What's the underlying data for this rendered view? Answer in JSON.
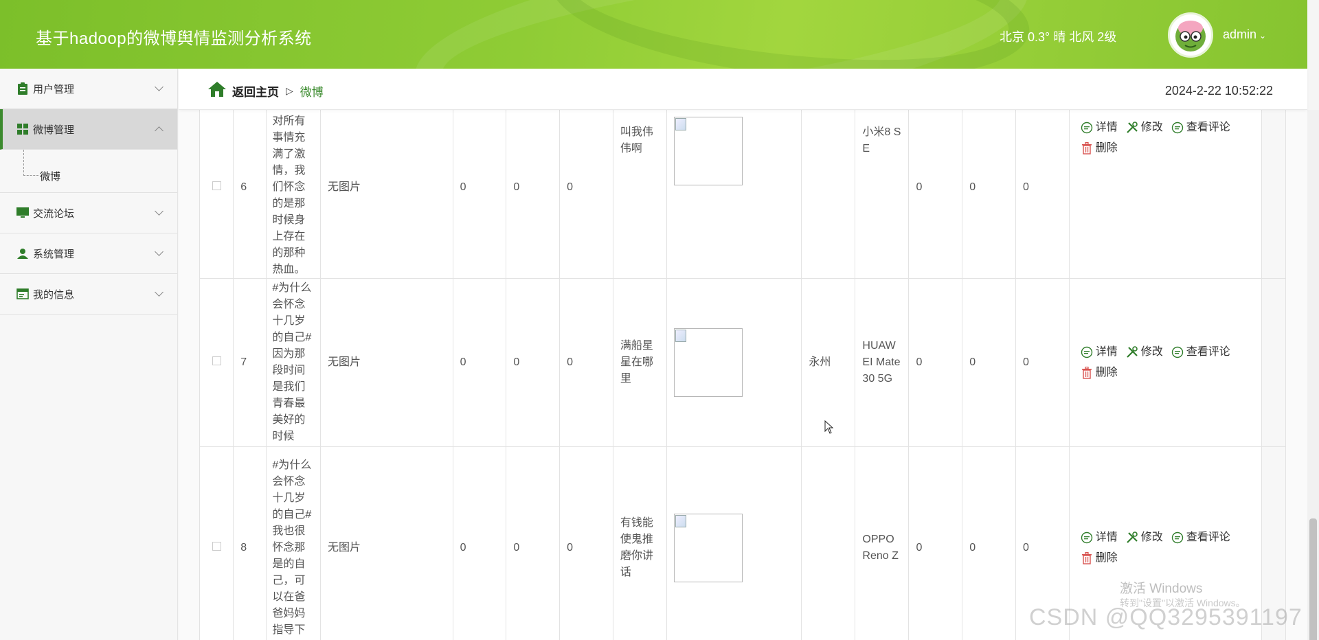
{
  "header": {
    "title": "基于hadoop的微博舆情监测分析系统",
    "weather": "北京 0.3° 晴 北风 2级",
    "user": "admin"
  },
  "sidebar": {
    "items": [
      {
        "label": "用户管理",
        "icon": "clipboard-icon"
      },
      {
        "label": "微博管理",
        "icon": "grid-icon"
      },
      {
        "label": "交流论坛",
        "icon": "monitor-icon"
      },
      {
        "label": "系统管理",
        "icon": "person-icon"
      },
      {
        "label": "我的信息",
        "icon": "id-card-icon"
      }
    ],
    "submenu": {
      "label": "微博"
    }
  },
  "breadcrumb": {
    "home": "返回主页",
    "separator": "▷",
    "current": "微博"
  },
  "datetime": "2024-2-22 10:52:22",
  "table": {
    "rows": [
      {
        "id": "6",
        "content": "的我们对所有事情充满了激情，我们怀念的是那时候身上存在的那种热血。",
        "pic": "无图片",
        "n1": "0",
        "n2": "0",
        "n3": "0",
        "nickname": "叫我伟伟啊",
        "location": "",
        "device": "小米8 SE",
        "m1": "0",
        "m2": "0",
        "m3": "0"
      },
      {
        "id": "7",
        "content": "#为什么会怀念十几岁的自己#因为那段时间是我们青春最美好的时候",
        "pic": "无图片",
        "n1": "0",
        "n2": "0",
        "n3": "0",
        "nickname": "满船星星在哪里",
        "location": "永州",
        "device": "HUAWEI Mate 30 5G",
        "m1": "0",
        "m2": "0",
        "m3": "0"
      },
      {
        "id": "8",
        "content": "#为什么会怀念十几岁的自己#我也很怀念那是的自己，可以在爸爸妈妈指导下",
        "pic": "无图片",
        "n1": "0",
        "n2": "0",
        "n3": "0",
        "nickname": "有钱能使鬼推磨你讲话",
        "location": "",
        "device": "OPPO Reno Z",
        "m1": "0",
        "m2": "0",
        "m3": "0"
      }
    ],
    "actions": {
      "detail": "详情",
      "edit": "修改",
      "comments": "查看评论",
      "delete": "删除"
    }
  },
  "overlay": {
    "win_activate": "激活 Windows",
    "win_hint": "转到\"设置\"以激活 Windows。",
    "csdn": "CSDN @QQ3295391197"
  }
}
